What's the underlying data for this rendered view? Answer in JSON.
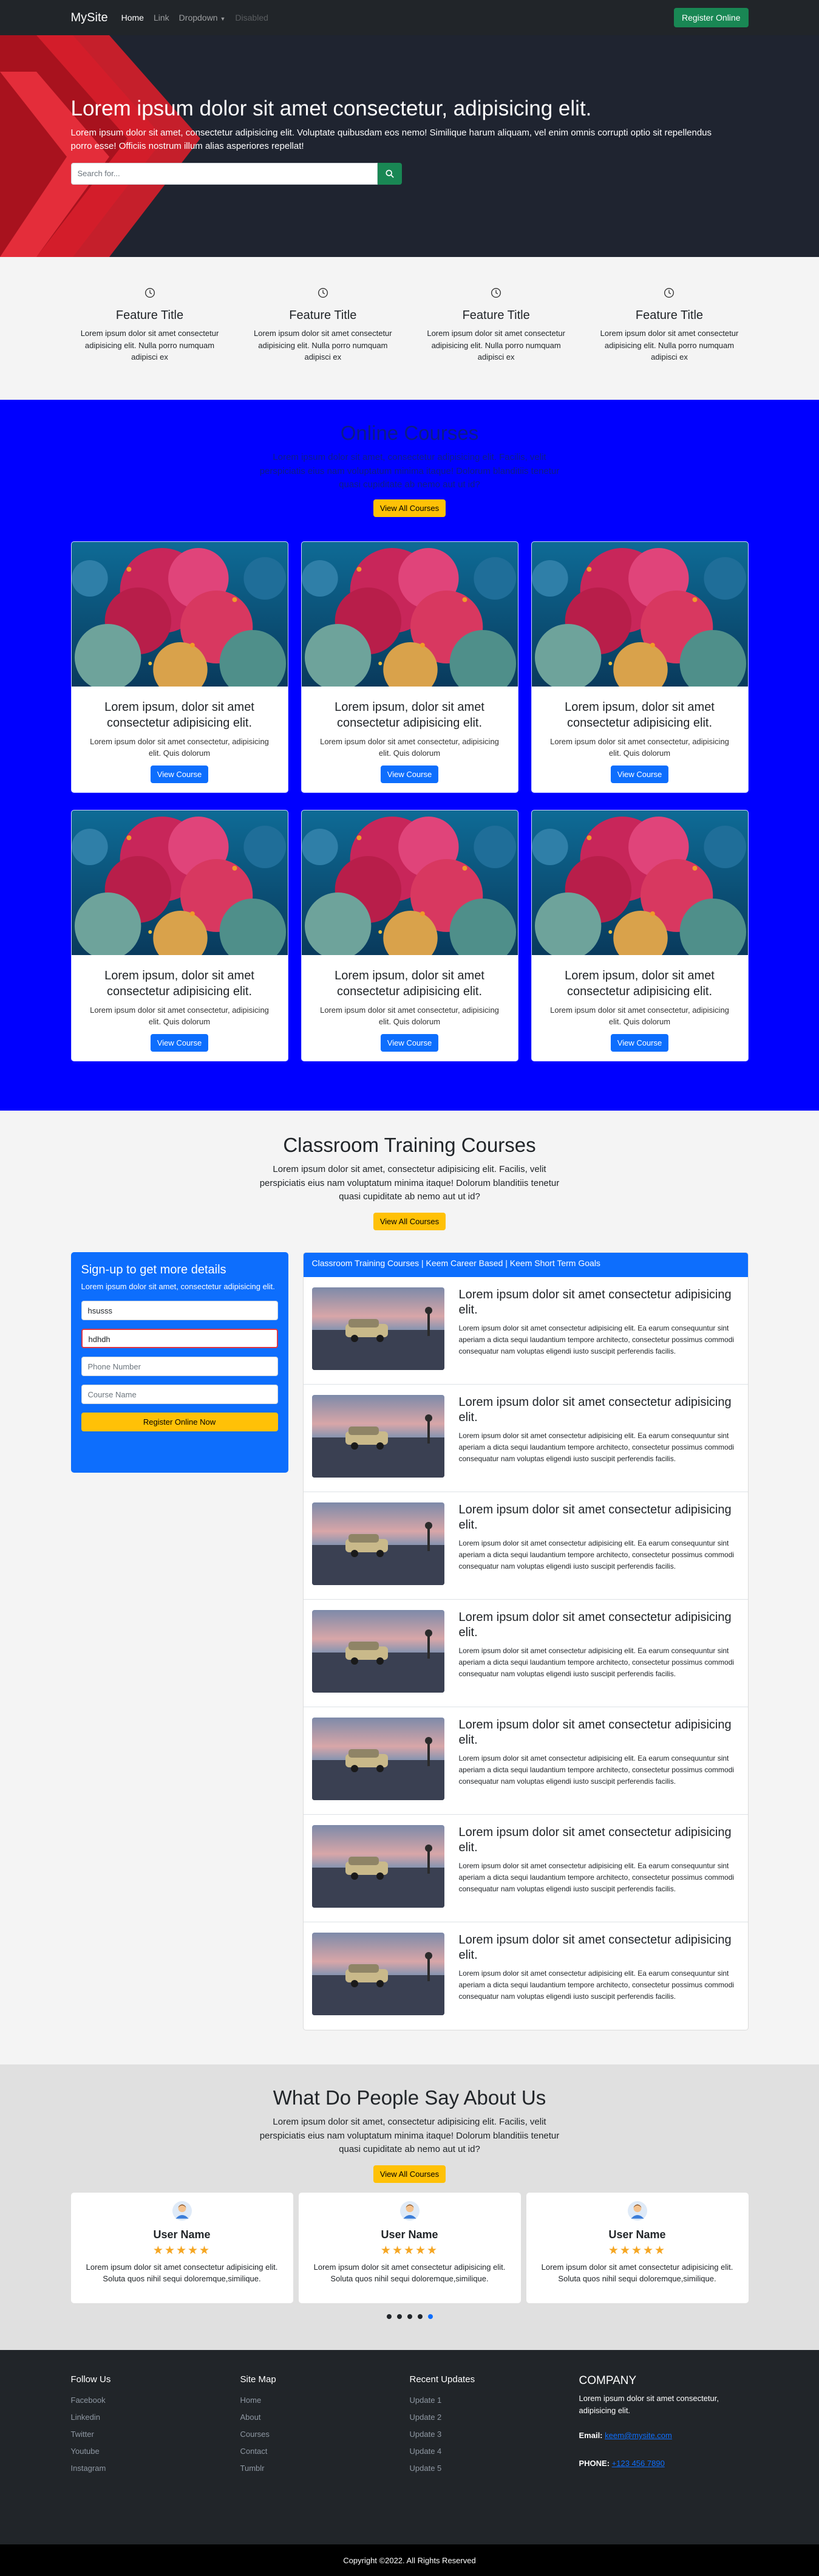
{
  "navbar": {
    "brand": "MySite",
    "links": [
      {
        "label": "Home"
      },
      {
        "label": "Link"
      },
      {
        "label": "Dropdown"
      },
      {
        "label": "Disabled"
      }
    ],
    "register_label": "Register Online"
  },
  "hero": {
    "title": "Lorem ipsum dolor sit amet consectetur, adipisicing elit.",
    "text": "Lorem ipsum dolor sit amet, consectetur adipisicing elit. Voluptate quibusdam eos nemo! Similique harum aliquam, vel enim omnis corrupti optio sit repellendus porro esse! Officiis nostrum illum alias asperiores repellat!",
    "search_placeholder": "Search for...",
    "search_icon": "search-icon"
  },
  "features": [
    {
      "icon": "clock-icon",
      "title": "Feature Title",
      "text": "Lorem ipsum dolor sit amet consectetur adipisicing elit. Nulla porro numquam adipisci ex"
    },
    {
      "icon": "clock-icon",
      "title": "Feature Title",
      "text": "Lorem ipsum dolor sit amet consectetur adipisicing elit. Nulla porro numquam adipisci ex"
    },
    {
      "icon": "clock-icon",
      "title": "Feature Title",
      "text": "Lorem ipsum dolor sit amet consectetur adipisicing elit. Nulla porro numquam adipisci ex"
    },
    {
      "icon": "clock-icon",
      "title": "Feature Title",
      "text": "Lorem ipsum dolor sit amet consectetur adipisicing elit. Nulla porro numquam adipisci ex"
    }
  ],
  "online": {
    "title": "Online Courses",
    "text": "Lorem ipsum dolor sit amet, consectetur adipisicing elit. Facilis, velit perspiciatis eius nam voluptatum minima itaque! Dolorum blanditiis tenetur quasi cupiditate ab nemo aut ut id?",
    "button": "View All Courses",
    "cards": [
      {
        "title": "Lorem ipsum, dolor sit amet consectetur adipisicing elit.",
        "text": "Lorem ipsum dolor sit amet consectetur, adipisicing elit. Quis dolorum",
        "button": "View Course"
      },
      {
        "title": "Lorem ipsum, dolor sit amet consectetur adipisicing elit.",
        "text": "Lorem ipsum dolor sit amet consectetur, adipisicing elit. Quis dolorum",
        "button": "View Course"
      },
      {
        "title": "Lorem ipsum, dolor sit amet consectetur adipisicing elit.",
        "text": "Lorem ipsum dolor sit amet consectetur, adipisicing elit. Quis dolorum",
        "button": "View Course"
      },
      {
        "title": "Lorem ipsum, dolor sit amet consectetur adipisicing elit.",
        "text": "Lorem ipsum dolor sit amet consectetur, adipisicing elit. Quis dolorum",
        "button": "View Course"
      },
      {
        "title": "Lorem ipsum, dolor sit amet consectetur adipisicing elit.",
        "text": "Lorem ipsum dolor sit amet consectetur, adipisicing elit. Quis dolorum",
        "button": "View Course"
      },
      {
        "title": "Lorem ipsum, dolor sit amet consectetur adipisicing elit.",
        "text": "Lorem ipsum dolor sit amet consectetur, adipisicing elit. Quis dolorum",
        "button": "View Course"
      }
    ]
  },
  "classroom": {
    "title": "Classroom Training Courses",
    "text": "Lorem ipsum dolor sit amet, consectetur adipisicing elit. Facilis, velit perspiciatis eius nam voluptatum minima itaque! Dolorum blanditiis tenetur quasi cupiditate ab nemo aut ut id?",
    "button": "View All Courses",
    "signup": {
      "title": "Sign-up to get more details",
      "text": "Lorem ipsum dolor sit amet, consectetur adipisicing elit.",
      "name_value": "hsusss",
      "email_value": "hdhdh",
      "phone_placeholder": "Phone Number",
      "course_placeholder": "Course Name",
      "button": "Register Online Now"
    },
    "list_header": "Classroom Training Courses | Keem Career Based | Keem Short Term Goals",
    "items": [
      {
        "title": "Lorem ipsum dolor sit amet consectetur adipisicing elit.",
        "text": "Lorem ipsum dolor sit amet consectetur adipisicing elit. Ea earum consequuntur sint aperiam a dicta sequi laudantium tempore architecto, consectetur possimus commodi consequatur nam voluptas eligendi iusto suscipit perferendis facilis."
      },
      {
        "title": "Lorem ipsum dolor sit amet consectetur adipisicing elit.",
        "text": "Lorem ipsum dolor sit amet consectetur adipisicing elit. Ea earum consequuntur sint aperiam a dicta sequi laudantium tempore architecto, consectetur possimus commodi consequatur nam voluptas eligendi iusto suscipit perferendis facilis."
      },
      {
        "title": "Lorem ipsum dolor sit amet consectetur adipisicing elit.",
        "text": "Lorem ipsum dolor sit amet consectetur adipisicing elit. Ea earum consequuntur sint aperiam a dicta sequi laudantium tempore architecto, consectetur possimus commodi consequatur nam voluptas eligendi iusto suscipit perferendis facilis."
      },
      {
        "title": "Lorem ipsum dolor sit amet consectetur adipisicing elit.",
        "text": "Lorem ipsum dolor sit amet consectetur adipisicing elit. Ea earum consequuntur sint aperiam a dicta sequi laudantium tempore architecto, consectetur possimus commodi consequatur nam voluptas eligendi iusto suscipit perferendis facilis."
      },
      {
        "title": "Lorem ipsum dolor sit amet consectetur adipisicing elit.",
        "text": "Lorem ipsum dolor sit amet consectetur adipisicing elit. Ea earum consequuntur sint aperiam a dicta sequi laudantium tempore architecto, consectetur possimus commodi consequatur nam voluptas eligendi iusto suscipit perferendis facilis."
      },
      {
        "title": "Lorem ipsum dolor sit amet consectetur adipisicing elit.",
        "text": "Lorem ipsum dolor sit amet consectetur adipisicing elit. Ea earum consequuntur sint aperiam a dicta sequi laudantium tempore architecto, consectetur possimus commodi consequatur nam voluptas eligendi iusto suscipit perferendis facilis."
      },
      {
        "title": "Lorem ipsum dolor sit amet consectetur adipisicing elit.",
        "text": "Lorem ipsum dolor sit amet consectetur adipisicing elit. Ea earum consequuntur sint aperiam a dicta sequi laudantium tempore architecto, consectetur possimus commodi consequatur nam voluptas eligendi iusto suscipit perferendis facilis."
      }
    ]
  },
  "testimonials": {
    "title": "What Do People Say About Us",
    "text": "Lorem ipsum dolor sit amet, consectetur adipisicing elit. Facilis, velit perspiciatis eius nam voluptatum minima itaque! Dolorum blanditiis tenetur quasi cupiditate ab nemo aut ut id?",
    "button": "View All Courses",
    "cards": [
      {
        "name": "User Name",
        "stars": "★★★★★",
        "text": "Lorem ipsum dolor sit amet consectetur adipisicing elit. Soluta quos nihil sequi doloremque,similique."
      },
      {
        "name": "User Name",
        "stars": "★★★★★",
        "text": "Lorem ipsum dolor sit amet consectetur adipisicing elit. Soluta quos nihil sequi doloremque,similique."
      },
      {
        "name": "User Name",
        "stars": "★★★★★",
        "text": "Lorem ipsum dolor sit amet consectetur adipisicing elit. Soluta quos nihil sequi doloremque,similique."
      }
    ],
    "active_slide": 5,
    "slide_count": 5
  },
  "footer": {
    "follow": {
      "title": "Follow Us",
      "links": [
        "Facebook",
        "Linkedin",
        "Twitter",
        "Youtube",
        "Instagram"
      ]
    },
    "sitemap": {
      "title": "Site Map",
      "links": [
        "Home",
        "About",
        "Courses",
        "Contact",
        "Tumblr"
      ]
    },
    "updates": {
      "title": "Recent Updates",
      "links": [
        "Update 1",
        "Update 2",
        "Update 3",
        "Update 4",
        "Update 5"
      ]
    },
    "company": {
      "title": "COMPANY",
      "text": "Lorem ipsum dolor sit amet consectetur, adipisicing elit.",
      "email_label": "Email:",
      "email": "keem@mysite.com",
      "phone_label": "PHONE:",
      "phone": "+123 456 7890"
    },
    "copyright": "Copyright ©2022. All Rights Reserved"
  },
  "colors": {
    "navbar_bg": "#212529",
    "hero_bg": "#1f2430",
    "online_bg": "#0000ff",
    "primary": "#0d6efd",
    "success": "#198754",
    "warning": "#ffc107"
  }
}
